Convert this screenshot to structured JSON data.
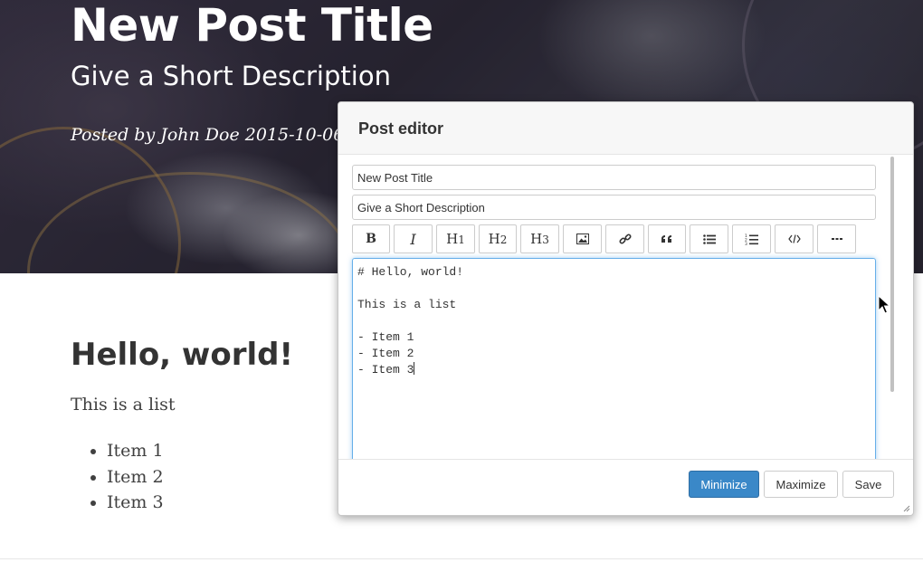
{
  "header": {
    "title": "New Post Title",
    "subtitle": "Give a Short Description",
    "meta": "Posted by John Doe 2015-10-06"
  },
  "article": {
    "heading": "Hello, world!",
    "paragraph": "This is a list",
    "items": [
      "Item 1",
      "Item 2",
      "Item 3"
    ]
  },
  "editor": {
    "title": "Post editor",
    "title_value": "New Post Title",
    "description_value": "Give a Short Description",
    "toolbar": [
      {
        "label": "B",
        "icon": "bold-icon"
      },
      {
        "label": "I",
        "icon": "italic-icon"
      },
      {
        "label": "H1",
        "icon": "heading-1-icon"
      },
      {
        "label": "H2",
        "icon": "heading-2-icon"
      },
      {
        "label": "H3",
        "icon": "heading-3-icon"
      },
      {
        "label": "",
        "icon": "image-icon"
      },
      {
        "label": "",
        "icon": "link-icon"
      },
      {
        "label": "",
        "icon": "quote-icon"
      },
      {
        "label": "",
        "icon": "bulleted-list-icon"
      },
      {
        "label": "",
        "icon": "numbered-list-icon"
      },
      {
        "label": "",
        "icon": "code-icon"
      },
      {
        "label": "",
        "icon": "more-icon"
      }
    ],
    "markdown": "# Hello, world!\n\nThis is a list\n\n- Item 1\n- Item 2\n- Item 3",
    "buttons": {
      "minimize": "Minimize",
      "maximize": "Maximize",
      "save": "Save"
    }
  },
  "colors": {
    "primary": "#3a88c8",
    "focus": "#66afe9"
  }
}
